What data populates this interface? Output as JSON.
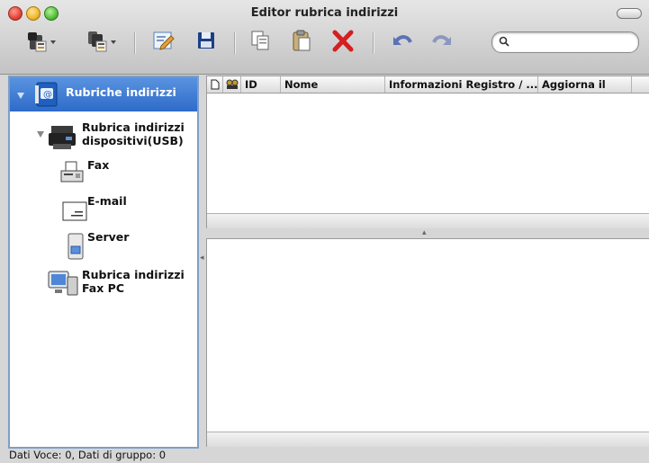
{
  "window": {
    "title": "Editor rubrica indirizzi"
  },
  "toolbar": {
    "buttons": [
      {
        "icon": "new-contact-menu-icon"
      },
      {
        "icon": "new-group-menu-icon"
      },
      {
        "icon": "edit-icon"
      },
      {
        "icon": "save-icon"
      },
      {
        "icon": "copy-icon"
      },
      {
        "icon": "paste-icon"
      },
      {
        "icon": "delete-icon"
      },
      {
        "icon": "undo-icon"
      },
      {
        "icon": "redo-icon"
      }
    ],
    "search": {
      "placeholder": "",
      "value": ""
    }
  },
  "sidebar": {
    "root": {
      "label": "Rubriche indirizzi",
      "icon": "address-book-icon"
    },
    "items": [
      {
        "label": "Rubrica indirizzi dispositivi(USB)",
        "line1": "Rubrica indirizzi",
        "line2": "dispositivi(USB)",
        "icon": "printer-device-icon"
      },
      {
        "label": "Fax",
        "icon": "fax-icon"
      },
      {
        "label": "E-mail",
        "icon": "email-icon"
      },
      {
        "label": "Server",
        "icon": "server-icon"
      },
      {
        "label": "Rubrica indirizzi Fax PC",
        "line1": "Rubrica indirizzi",
        "line2": "Fax PC",
        "icon": "pc-fax-icon"
      }
    ]
  },
  "table": {
    "columns": [
      {
        "label": "",
        "icon": "document-icon"
      },
      {
        "label": "",
        "icon": "group-icon"
      },
      {
        "label": "ID"
      },
      {
        "label": "Nome"
      },
      {
        "label": "Informazioni Registro / ..."
      },
      {
        "label": "Aggiorna il"
      }
    ],
    "rows": []
  },
  "status": {
    "text": "Dati Voce: 0, Dati di gruppo: 0"
  },
  "colors": {
    "selection": "#3370cf",
    "sidebar_border": "#7d9fc9",
    "delete": "#d42020"
  }
}
